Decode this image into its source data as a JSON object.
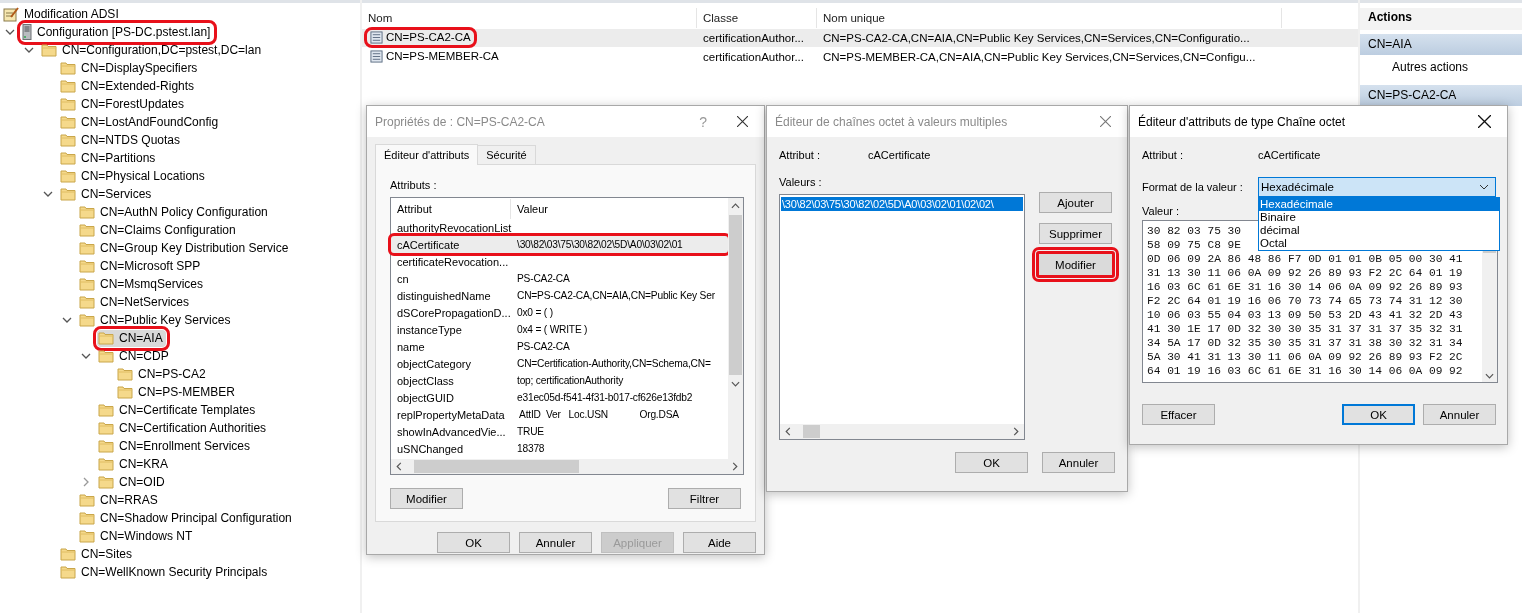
{
  "tree": {
    "root": {
      "label": "Modification ADSI"
    },
    "items": [
      {
        "label": "Configuration [PS-DC.pstest.lan]",
        "expanded": true,
        "selected": false,
        "highlighted": true,
        "children": [
          {
            "label": "CN=Configuration,DC=pstest,DC=lan",
            "expanded": true,
            "selected": false,
            "highlighted": false,
            "children": [
              {
                "label": "CN=DisplaySpecifiers",
                "selected": false,
                "highlighted": false
              },
              {
                "label": "CN=Extended-Rights",
                "selected": false,
                "highlighted": false
              },
              {
                "label": "CN=ForestUpdates",
                "selected": false,
                "highlighted": false
              },
              {
                "label": "CN=LostAndFoundConfig",
                "selected": false,
                "highlighted": false
              },
              {
                "label": "CN=NTDS Quotas",
                "selected": false,
                "highlighted": false
              },
              {
                "label": "CN=Partitions",
                "selected": false,
                "highlighted": false
              },
              {
                "label": "CN=Physical Locations",
                "selected": false,
                "highlighted": false
              },
              {
                "label": "CN=Services",
                "expanded": true,
                "selected": false,
                "highlighted": false,
                "children": [
                  {
                    "label": "CN=AuthN Policy Configuration",
                    "selected": false,
                    "highlighted": false
                  },
                  {
                    "label": "CN=Claims Configuration",
                    "selected": false,
                    "highlighted": false
                  },
                  {
                    "label": "CN=Group Key Distribution Service",
                    "selected": false,
                    "highlighted": false
                  },
                  {
                    "label": "CN=Microsoft SPP",
                    "selected": false,
                    "highlighted": false
                  },
                  {
                    "label": "CN=MsmqServices",
                    "selected": false,
                    "highlighted": false
                  },
                  {
                    "label": "CN=NetServices",
                    "selected": false,
                    "highlighted": false
                  },
                  {
                    "label": "CN=Public Key Services",
                    "expanded": true,
                    "selected": false,
                    "highlighted": false,
                    "children": [
                      {
                        "label": "CN=AIA",
                        "selected": true,
                        "highlighted": true
                      },
                      {
                        "label": "CN=CDP",
                        "expanded": true,
                        "selected": false,
                        "highlighted": false,
                        "children": [
                          {
                            "label": "CN=PS-CA2",
                            "selected": false,
                            "highlighted": false
                          },
                          {
                            "label": "CN=PS-MEMBER",
                            "selected": false,
                            "highlighted": false
                          }
                        ]
                      },
                      {
                        "label": "CN=Certificate Templates",
                        "selected": false,
                        "highlighted": false
                      },
                      {
                        "label": "CN=Certification Authorities",
                        "selected": false,
                        "highlighted": false
                      },
                      {
                        "label": "CN=Enrollment Services",
                        "selected": false,
                        "highlighted": false
                      },
                      {
                        "label": "CN=KRA",
                        "selected": false,
                        "highlighted": false
                      },
                      {
                        "label": "CN=OID",
                        "expanded": false,
                        "selected": false,
                        "highlighted": false
                      }
                    ]
                  },
                  {
                    "label": "CN=RRAS",
                    "selected": false,
                    "highlighted": false
                  },
                  {
                    "label": "CN=Shadow Principal Configuration",
                    "selected": false,
                    "highlighted": false
                  },
                  {
                    "label": "CN=Windows NT",
                    "selected": false,
                    "highlighted": false
                  }
                ]
              },
              {
                "label": "CN=Sites",
                "selected": false,
                "highlighted": false
              },
              {
                "label": "CN=WellKnown Security Principals",
                "selected": false,
                "highlighted": false
              }
            ]
          }
        ]
      }
    ]
  },
  "object_list": {
    "columns": [
      "Nom",
      "Classe",
      "Nom unique"
    ],
    "rows": [
      {
        "name": "CN=PS-CA2-CA",
        "class": "certificationAuthor...",
        "distinguished_name": "CN=PS-CA2-CA,CN=AIA,CN=Public Key Services,CN=Services,CN=Configuratio...",
        "selected": true,
        "highlighted": true
      },
      {
        "name": "CN=PS-MEMBER-CA",
        "class": "certificationAuthor...",
        "distinguished_name": "CN=PS-MEMBER-CA,CN=AIA,CN=Public Key Services,CN=Services,CN=Configu...",
        "selected": false,
        "highlighted": false
      }
    ]
  },
  "actions_panel": {
    "title": "Actions",
    "sections": [
      {
        "header": "CN=AIA",
        "items": [
          "Autres actions"
        ]
      },
      {
        "header": "CN=PS-CA2-CA"
      }
    ]
  },
  "properties_dialog": {
    "title": "Propriétés de : CN=PS-CA2-CA",
    "help": "?",
    "tabs": [
      {
        "label": "Éditeur d'attributs",
        "selected": true
      },
      {
        "label": "Sécurité",
        "selected": false
      }
    ],
    "attributes_label": "Attributs :",
    "columns": [
      "Attribut",
      "Valeur"
    ],
    "rows": [
      {
        "attribute": "authorityRevocationList",
        "value": "",
        "highlighted": false
      },
      {
        "attribute": "cACertificate",
        "value": "\\30\\82\\03\\75\\30\\82\\02\\5D\\A0\\03\\02\\01",
        "highlighted": true
      },
      {
        "attribute": "certificateRevocation...",
        "value": "",
        "highlighted": false
      },
      {
        "attribute": "cn",
        "value": "PS-CA2-CA",
        "highlighted": false
      },
      {
        "attribute": "distinguishedName",
        "value": "CN=PS-CA2-CA,CN=AIA,CN=Public Key Ser",
        "highlighted": false
      },
      {
        "attribute": "dSCorePropagationD...",
        "value": "0x0 = ( )",
        "highlighted": false
      },
      {
        "attribute": "instanceType",
        "value": "0x4 = ( WRITE )",
        "highlighted": false
      },
      {
        "attribute": "name",
        "value": "PS-CA2-CA",
        "highlighted": false
      },
      {
        "attribute": "objectCategory",
        "value": "CN=Certification-Authority,CN=Schema,CN=",
        "highlighted": false
      },
      {
        "attribute": "objectClass",
        "value": "top; certificationAuthority",
        "highlighted": false
      },
      {
        "attribute": "objectGUID",
        "value": "e31ec05d-f541-4f31-b017-cf626e13fdb2",
        "highlighted": false
      },
      {
        "attribute": "replPropertyMetaData",
        "value": " AttID  Ver   Loc.USN            Org.DSA",
        "highlighted": false
      },
      {
        "attribute": "showInAdvancedVie...",
        "value": "TRUE",
        "highlighted": false
      },
      {
        "attribute": "uSNChanged",
        "value": "18378",
        "highlighted": false
      }
    ],
    "list_buttons": [
      "Modifier",
      "Filtrer"
    ],
    "buttons": [
      {
        "label": "OK",
        "disabled": false
      },
      {
        "label": "Annuler",
        "disabled": false
      },
      {
        "label": "Appliquer",
        "disabled": true
      },
      {
        "label": "Aide",
        "disabled": false
      }
    ]
  },
  "multivalue_dialog": {
    "title": "Éditeur de chaînes octet à valeurs multiples",
    "attribute_label": "Attribut :",
    "attribute_value": "cACertificate",
    "values_label": "Valeurs :",
    "values": [
      {
        "text": "\\30\\82\\03\\75\\30\\82\\02\\5D\\A0\\03\\02\\01\\02\\02\\",
        "selected": true
      }
    ],
    "side_buttons": [
      {
        "label": "Ajouter",
        "highlighted": false
      },
      {
        "label": "Supprimer",
        "highlighted": false
      },
      {
        "label": "Modifier",
        "highlighted": true
      }
    ],
    "buttons": [
      "OK",
      "Annuler"
    ]
  },
  "octet_dialog": {
    "title": "Éditeur d'attributs de type Chaîne octet",
    "attribute_label": "Attribut :",
    "attribute_value": "cACertificate",
    "format_label": "Format de la valeur :",
    "format": {
      "value": "Hexadécimale",
      "expanded": true,
      "options": [
        {
          "label": "Hexadécimale",
          "selected": true
        },
        {
          "label": "Binaire",
          "selected": false
        },
        {
          "label": "décimal",
          "selected": false
        },
        {
          "label": "Octal",
          "selected": false
        }
      ]
    },
    "value_label": "Valeur :",
    "hex_rows": [
      "30 82 03 75 30",
      "58 09 75 C8 9E",
      "0D 06 09 2A 86 48 86 F7 0D 01 01 0B 05 00 30 41",
      "31 13 30 11 06 0A 09 92 26 89 93 F2 2C 64 01 19",
      "16 03 6C 61 6E 31 16 30 14 06 0A 09 92 26 89 93",
      "F2 2C 64 01 19 16 06 70 73 74 65 73 74 31 12 30",
      "10 06 03 55 04 03 13 09 50 53 2D 43 41 32 2D 43",
      "41 30 1E 17 0D 32 30 30 35 31 37 31 37 35 32 31",
      "34 5A 17 0D 32 35 30 35 31 37 31 38 30 32 31 34",
      "5A 30 41 31 13 30 11 06 0A 09 92 26 89 93 F2 2C",
      "64 01 19 16 03 6C 61 6E 31 16 30 14 06 0A 09 92"
    ],
    "buttons": [
      {
        "label": "Effacer",
        "default": false
      },
      {
        "label": "OK",
        "default": true
      },
      {
        "label": "Annuler",
        "default": false
      }
    ]
  }
}
